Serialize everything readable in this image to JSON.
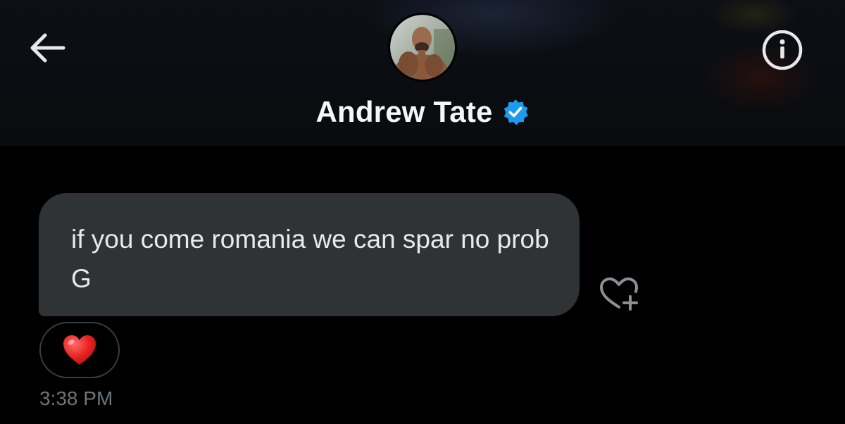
{
  "header": {
    "back_icon": "arrow-left-icon",
    "info_icon": "info-circle-icon",
    "display_name": "Andrew Tate",
    "verified_icon": "verified-badge-icon",
    "verified_color": "#1d9bf0"
  },
  "messages": [
    {
      "text": "if you come romania we can spar no prob G",
      "bubble_color": "#2f3336",
      "reaction": "❤️",
      "add_reaction_icon": "heart-plus-icon",
      "timestamp": "3:38 PM"
    }
  ],
  "colors": {
    "background": "#000000",
    "muted_text": "#6e767d",
    "primary_text": "#e7e9ea"
  }
}
